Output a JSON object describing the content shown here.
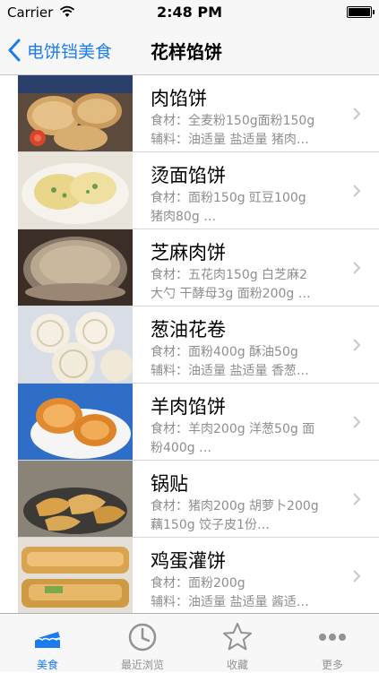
{
  "status_bar": {
    "carrier": "Carrier",
    "time": "2:48 PM"
  },
  "nav": {
    "back_label": "电饼铛美食",
    "title": "花样馅饼"
  },
  "recipes": [
    {
      "title": "肉馅饼",
      "line1": "食材：全麦粉150g面粉150g",
      "line2": "辅料：油适量 盐适量 猪肉…"
    },
    {
      "title": "烫面馅饼",
      "line1": "食材：面粉150g 豇豆100g",
      "line2": "猪肉80g …"
    },
    {
      "title": "芝麻肉饼",
      "line1": "食材：五花肉150g 白芝麻2",
      "line2": "大勺 干酵母3g 面粉200g …"
    },
    {
      "title": "葱油花卷",
      "line1": "食材：面粉400g 酥油50g",
      "line2": "辅料：油适量 盐适量 香葱…"
    },
    {
      "title": "羊肉馅饼",
      "line1": "食材：羊肉200g 洋葱50g 面",
      "line2": "粉400g …"
    },
    {
      "title": "锅贴",
      "line1": "食材：猪肉200g 胡萝卜200g",
      "line2": "藕150g 饺子皮1份…"
    },
    {
      "title": "鸡蛋灌饼",
      "line1": "食材：面粉200g",
      "line2": "辅料：油适量 盐适量 酱适…"
    }
  ],
  "tabs": [
    {
      "label": "美食",
      "icon": "cake-icon",
      "active": true
    },
    {
      "label": "最近浏览",
      "icon": "clock-icon",
      "active": false
    },
    {
      "label": "收藏",
      "icon": "star-icon",
      "active": false
    },
    {
      "label": "更多",
      "icon": "more-icon",
      "active": false
    }
  ],
  "colors": {
    "accent": "#1a7cf0",
    "tab_inactive": "#929292",
    "subtitle": "#8e8e93"
  }
}
